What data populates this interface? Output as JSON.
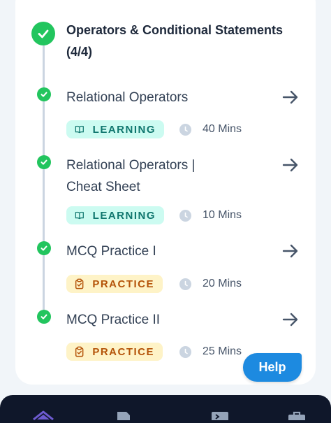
{
  "section": {
    "title": "Operators & Conditional Statements (4/4)"
  },
  "items": [
    {
      "title": "Relational Operators",
      "type": "LEARNING",
      "duration": "40 Mins"
    },
    {
      "title": "Relational Operators | Cheat Sheet",
      "type": "LEARNING",
      "duration": "10 Mins"
    },
    {
      "title": "MCQ Practice I",
      "type": "PRACTICE",
      "duration": "20 Mins"
    },
    {
      "title": "MCQ Practice II",
      "type": "PRACTICE",
      "duration": "25 Mins"
    }
  ],
  "help": {
    "label": "Help"
  },
  "icons": {
    "check": "check-icon",
    "arrow": "arrow-right-icon",
    "learning": "book-icon",
    "practice": "clipboard-check-icon",
    "duration": "clock-icon"
  },
  "colors": {
    "success": "#22c55e",
    "learning_bg": "#ccfbf1",
    "learning_fg": "#0f766e",
    "practice_bg": "#fef3c7",
    "practice_fg": "#b45309",
    "help": "#1d8ae0",
    "nav_bg": "#0f172a"
  }
}
